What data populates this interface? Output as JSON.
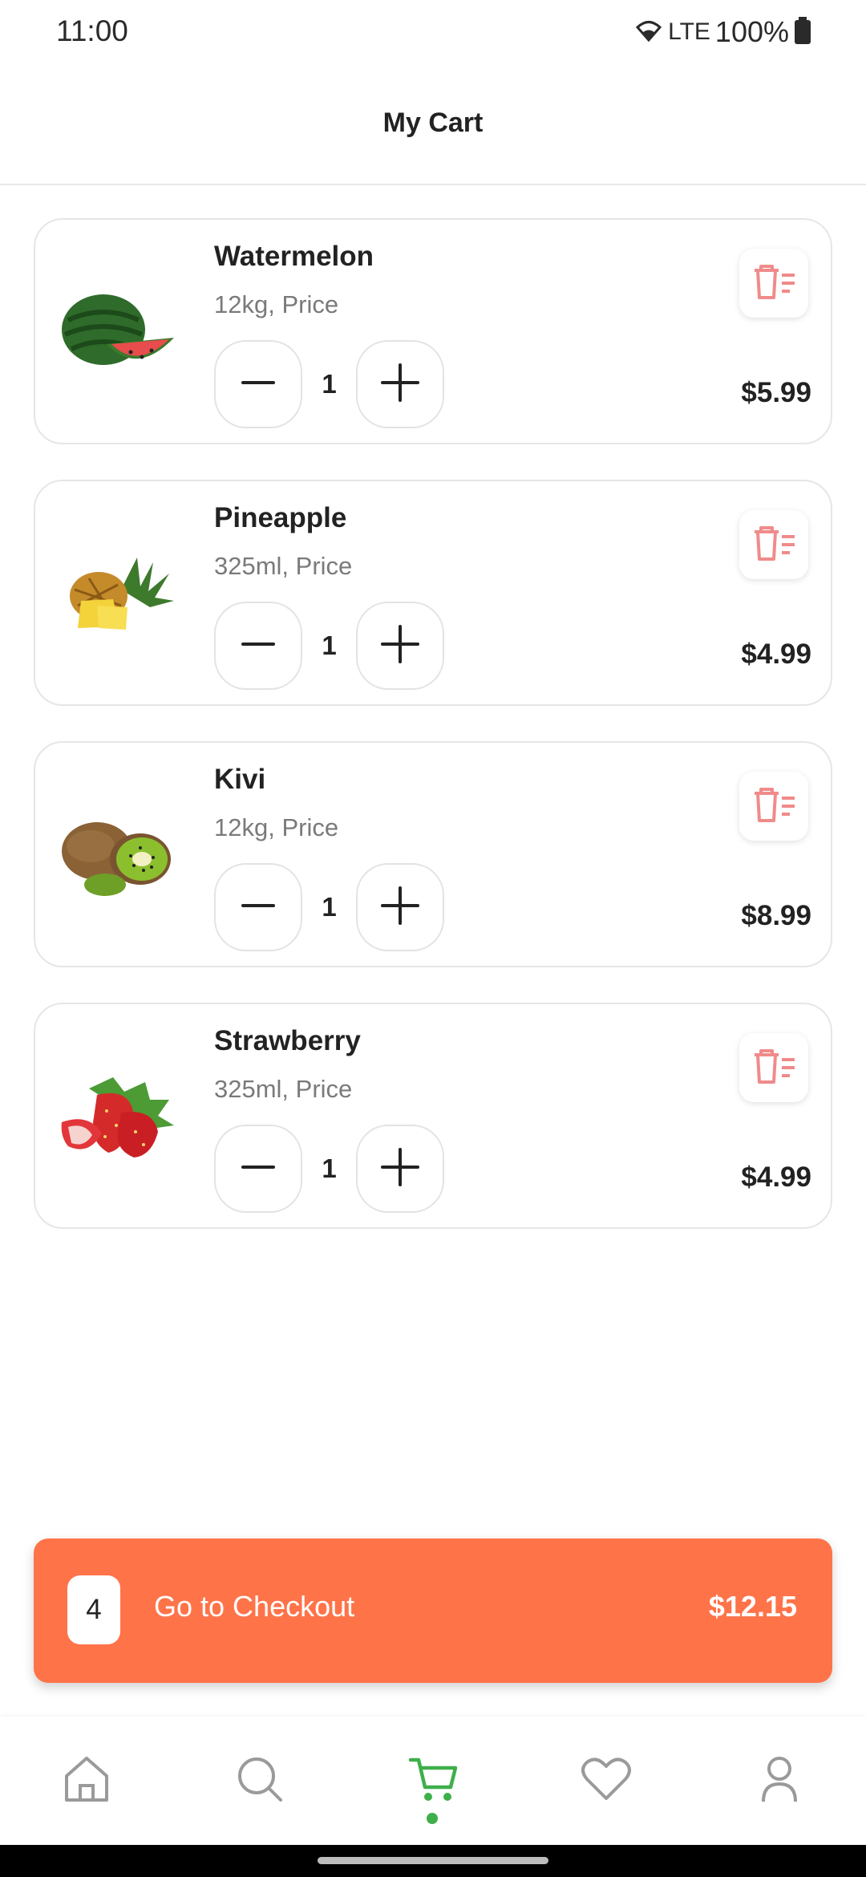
{
  "status_bar": {
    "time": "11:00",
    "network": "LTE",
    "battery": "100%"
  },
  "header": {
    "title": "My Cart"
  },
  "cart": {
    "items": [
      {
        "name": "Watermelon",
        "subtitle": "12kg, Price",
        "quantity": "1",
        "price": "$5.99",
        "image": "watermelon"
      },
      {
        "name": "Pineapple",
        "subtitle": "325ml, Price",
        "quantity": "1",
        "price": "$4.99",
        "image": "pineapple"
      },
      {
        "name": "Kivi",
        "subtitle": "12kg, Price",
        "quantity": "1",
        "price": "$8.99",
        "image": "kiwi"
      },
      {
        "name": "Strawberry",
        "subtitle": "325ml, Price",
        "quantity": "1",
        "price": "$4.99",
        "image": "strawberry"
      }
    ]
  },
  "checkout": {
    "count": "4",
    "label": "Go to Checkout",
    "total": "$12.15"
  },
  "bottom_nav": {
    "items": [
      {
        "icon": "home-icon",
        "active": false
      },
      {
        "icon": "search-icon",
        "active": false
      },
      {
        "icon": "cart-icon",
        "active": true
      },
      {
        "icon": "heart-icon",
        "active": false
      },
      {
        "icon": "profile-icon",
        "active": false
      }
    ]
  },
  "colors": {
    "accent": "#FF7349",
    "active_nav": "#3FAF4A",
    "delete_icon": "#F08B8B",
    "text_primary": "#222222",
    "text_secondary": "#7A7A7A"
  }
}
